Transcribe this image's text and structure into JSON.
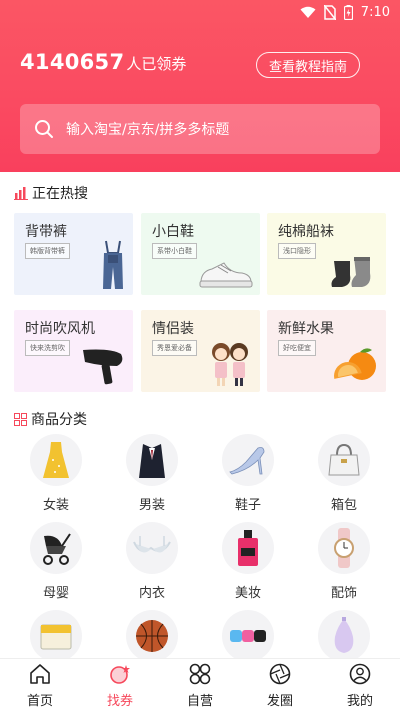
{
  "status_bar": {
    "time": "7:10"
  },
  "header": {
    "coupon_count": "4140657",
    "coupon_suffix": "人已领券",
    "guide_button": "查看教程指南",
    "search_placeholder": "输入淘宝/京东/拼多多标题"
  },
  "hot": {
    "title": "正在热搜",
    "items": [
      {
        "name": "背带裤",
        "tag": "韩版背带裤",
        "bg": "#eef2fb",
        "icon": "overalls-image"
      },
      {
        "name": "小白鞋",
        "tag": "系带小白鞋",
        "bg": "#eefaf0",
        "icon": "white-sneaker-image"
      },
      {
        "name": "纯棉船袜",
        "tag": "浅口隐形",
        "bg": "#fbfbe6",
        "icon": "socks-image"
      },
      {
        "name": "时尚吹风机",
        "tag": "快来洗剪吹",
        "bg": "#fbeefb",
        "icon": "hair-dryer-image"
      },
      {
        "name": "情侣装",
        "tag": "秀恩爱必备",
        "bg": "#fbf4e6",
        "icon": "couple-outfit-image"
      },
      {
        "name": "新鲜水果",
        "tag": "好吃便宜",
        "bg": "#fbeeee",
        "icon": "orange-fruit-image"
      }
    ]
  },
  "categories": {
    "title": "商品分类",
    "items": [
      {
        "label": "女装",
        "icon": "dress-icon"
      },
      {
        "label": "男装",
        "icon": "suit-icon"
      },
      {
        "label": "鞋子",
        "icon": "high-heel-icon"
      },
      {
        "label": "箱包",
        "icon": "handbag-icon"
      },
      {
        "label": "母婴",
        "icon": "stroller-icon"
      },
      {
        "label": "内衣",
        "icon": "bra-icon"
      },
      {
        "label": "美妆",
        "icon": "perfume-icon"
      },
      {
        "label": "配饰",
        "icon": "watch-icon"
      },
      {
        "label": "",
        "icon": "food-box-icon"
      },
      {
        "label": "",
        "icon": "basketball-icon"
      },
      {
        "label": "",
        "icon": "gadget-icon"
      },
      {
        "label": "",
        "icon": "humidifier-icon"
      }
    ]
  },
  "bottom_nav": {
    "items": [
      {
        "label": "首页",
        "icon": "home-icon"
      },
      {
        "label": "找券",
        "icon": "coupon-icon",
        "active": true
      },
      {
        "label": "自营",
        "icon": "grid-icon"
      },
      {
        "label": "发圈",
        "icon": "aperture-icon"
      },
      {
        "label": "我的",
        "icon": "profile-icon"
      }
    ]
  },
  "colors": {
    "brand": "#fa4a61",
    "active_nav": "#f6485b"
  }
}
